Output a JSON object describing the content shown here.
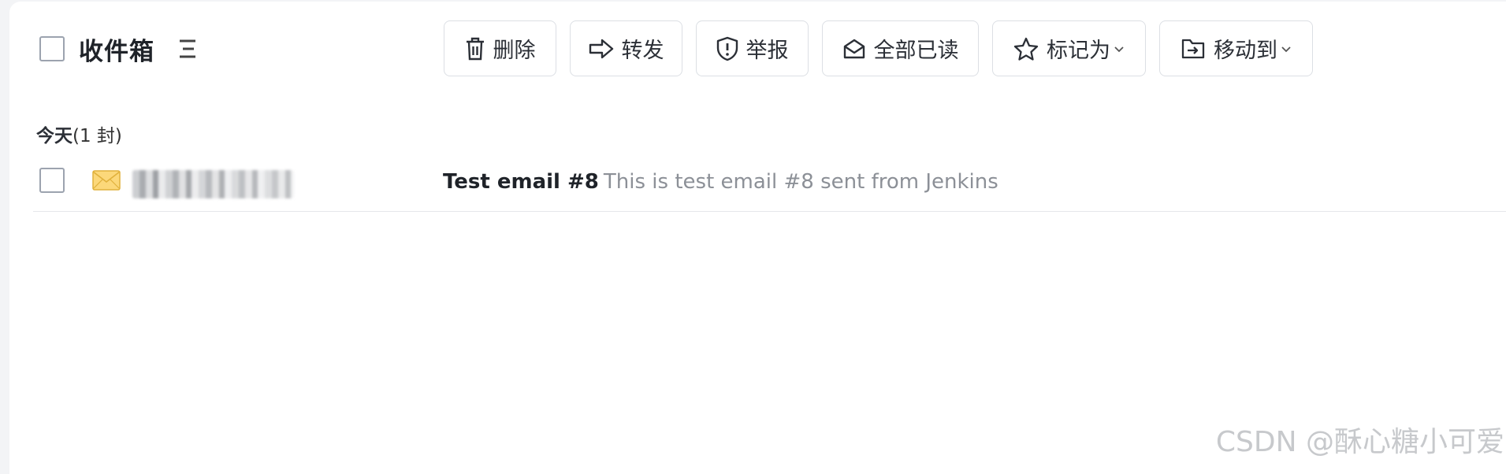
{
  "header": {
    "title": "收件箱"
  },
  "toolbar": {
    "delete_label": "删除",
    "forward_label": "转发",
    "report_label": "举报",
    "mark_all_read_label": "全部已读",
    "mark_as_label": "标记为",
    "move_to_label": "移动到"
  },
  "section": {
    "name": "今天",
    "count": "(1 封)"
  },
  "emails": [
    {
      "subject": "Test email #8",
      "preview": "This is test email #8 sent from Jenkins"
    }
  ],
  "watermark": "CSDN @酥心糖小可爱"
}
